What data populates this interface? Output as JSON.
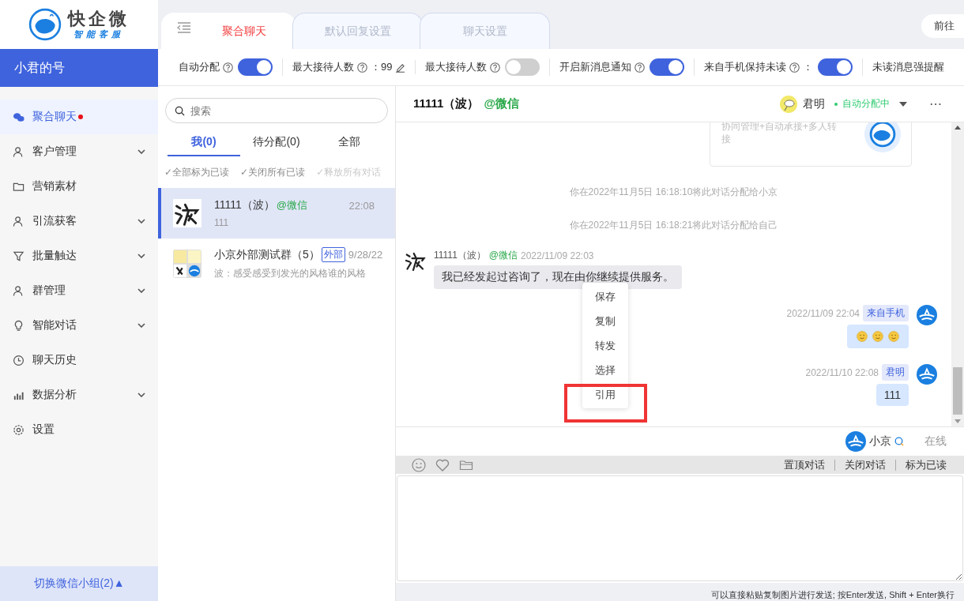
{
  "logo": {
    "name": "快企微",
    "tagline": "智能客服"
  },
  "account": {
    "name": "小君的号"
  },
  "sidebar": {
    "items": [
      {
        "label": "聚合聊天",
        "selected": true,
        "unread": true,
        "has_submenu": false
      },
      {
        "label": "客户管理",
        "selected": false,
        "unread": false,
        "has_submenu": true
      },
      {
        "label": "营销素材",
        "selected": false,
        "unread": false,
        "has_submenu": false
      },
      {
        "label": "引流获客",
        "selected": false,
        "unread": false,
        "has_submenu": true
      },
      {
        "label": "批量触达",
        "selected": false,
        "unread": false,
        "has_submenu": true
      },
      {
        "label": "群管理",
        "selected": false,
        "unread": false,
        "has_submenu": true
      },
      {
        "label": "智能对话",
        "selected": false,
        "unread": false,
        "has_submenu": true
      },
      {
        "label": "聊天历史",
        "selected": false,
        "unread": false,
        "has_submenu": false
      },
      {
        "label": "数据分析",
        "selected": false,
        "unread": false,
        "has_submenu": true
      },
      {
        "label": "设置",
        "selected": false,
        "unread": false,
        "has_submenu": false
      }
    ],
    "footer": "切换微信小组(2)▲"
  },
  "tabs": [
    {
      "label": "聚合聊天",
      "selected": true
    },
    {
      "label": "默认回复设置",
      "selected": false
    },
    {
      "label": "聊天设置",
      "selected": false
    }
  ],
  "top_button": "前往",
  "settings": [
    {
      "kind": "toggle",
      "label": "自动分配",
      "help": true,
      "on": true
    },
    {
      "kind": "value",
      "label": "最大接待人数",
      "help": true,
      "value": "：99"
    },
    {
      "kind": "toggle",
      "label": "最大接待人数",
      "help": true,
      "on": false
    },
    {
      "kind": "toggle",
      "label": "开启新消息通知",
      "help": true,
      "on": true
    },
    {
      "kind": "toggle",
      "label": "来自手机保持未读",
      "help": true,
      "suffix": "：",
      "on": true
    },
    {
      "kind": "text",
      "label": "未读消息强提醒",
      "help": false
    }
  ],
  "search": {
    "placeholder": "搜索"
  },
  "list_tabs": [
    {
      "label": "我(0)",
      "selected": true
    },
    {
      "label": "待分配(0)",
      "selected": false
    },
    {
      "label": "全部",
      "selected": false
    }
  ],
  "bulk_actions": [
    {
      "label": "✓全部标为已读",
      "disabled": false
    },
    {
      "label": "✓关闭所有已读",
      "disabled": false
    },
    {
      "label": "✓释放所有对话",
      "disabled": true
    }
  ],
  "conversations": [
    {
      "kind": "single",
      "name": "11111（波）",
      "source": "@微信",
      "time": "22:08",
      "preview": "111",
      "selected": true
    },
    {
      "kind": "group",
      "name": "小京外部测试群（5）",
      "tag": "外部",
      "time": "9/28/22",
      "preview": "波：感受感受到发光的风格谁的风格",
      "selected": false
    }
  ],
  "chat": {
    "title": "11111（波）",
    "source": "@微信",
    "agent": "君明",
    "agent_status": "自动分配中",
    "more": "⋯",
    "card_text": "协同管理+自动承接+多人转接",
    "messages": [
      {
        "kind": "system",
        "text": "你在2022年11月5日 16:18:10将此对话分配给小京"
      },
      {
        "kind": "system",
        "text": "你在2022年11月5日 16:18:21将此对话分配给自己"
      },
      {
        "kind": "incoming",
        "name": "11111（波）",
        "source": "@微信",
        "time": "2022/11/09 22:03",
        "text": "我已经发起过咨询了，现在由你继续提供服务。"
      },
      {
        "kind": "outgoing",
        "time": "2022/11/09 22:04",
        "tag": "来自手机",
        "emojis": [
          {
            "kind": "smile"
          },
          {
            "kind": "smile"
          },
          {
            "kind": "smile"
          }
        ]
      },
      {
        "kind": "outgoing",
        "time": "2022/11/10 22:08",
        "tag": "君明",
        "text": "111"
      }
    ],
    "context_menu": [
      {
        "label": "保存",
        "marked": false
      },
      {
        "label": "复制",
        "marked": false
      },
      {
        "label": "转发",
        "marked": false
      },
      {
        "label": "选择",
        "marked": false
      },
      {
        "label": "引用",
        "marked": true
      }
    ],
    "online": {
      "name": "小京",
      "status": "在线"
    },
    "actions": [
      "置顶对话",
      "关闭对话",
      "标为已读"
    ],
    "hint": "可以直接粘贴复制图片进行发送; 按Enter发送, Shift + Enter换行"
  }
}
